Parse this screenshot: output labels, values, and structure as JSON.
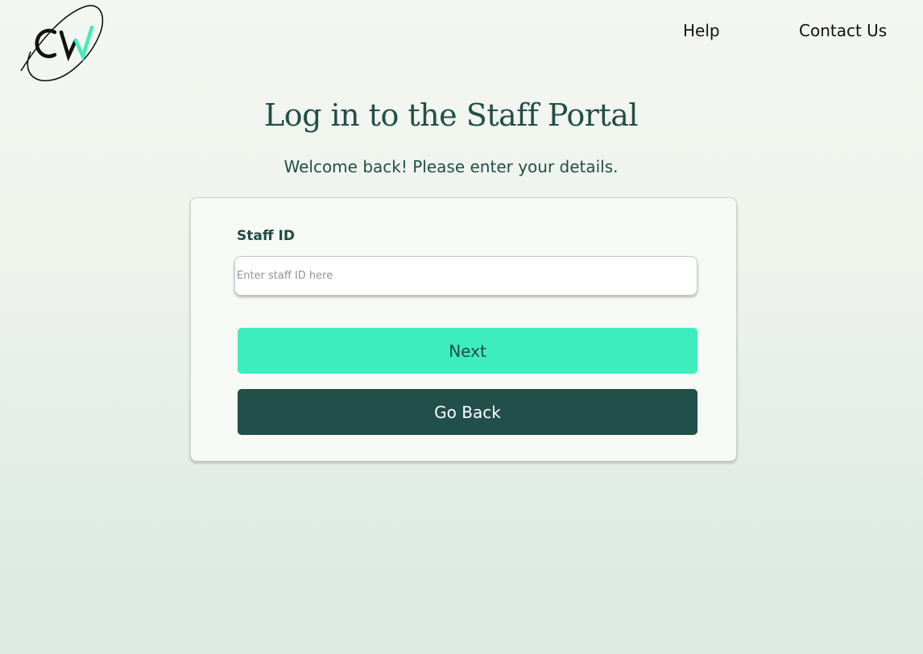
{
  "header": {
    "logo_text": "CW",
    "nav": [
      {
        "label": "Help"
      },
      {
        "label": "Contact Us"
      }
    ]
  },
  "main": {
    "title": "Log in to the Staff Portal",
    "subtitle": "Welcome back! Please enter your details."
  },
  "form": {
    "staff_id_label": "Staff ID",
    "staff_id_placeholder": "Enter staff ID here",
    "staff_id_value": "",
    "next_label": "Next",
    "back_label": "Go Back"
  },
  "colors": {
    "primary_dark": "#214f49",
    "accent": "#3dedbd",
    "card_background": "#f7f9f4"
  }
}
